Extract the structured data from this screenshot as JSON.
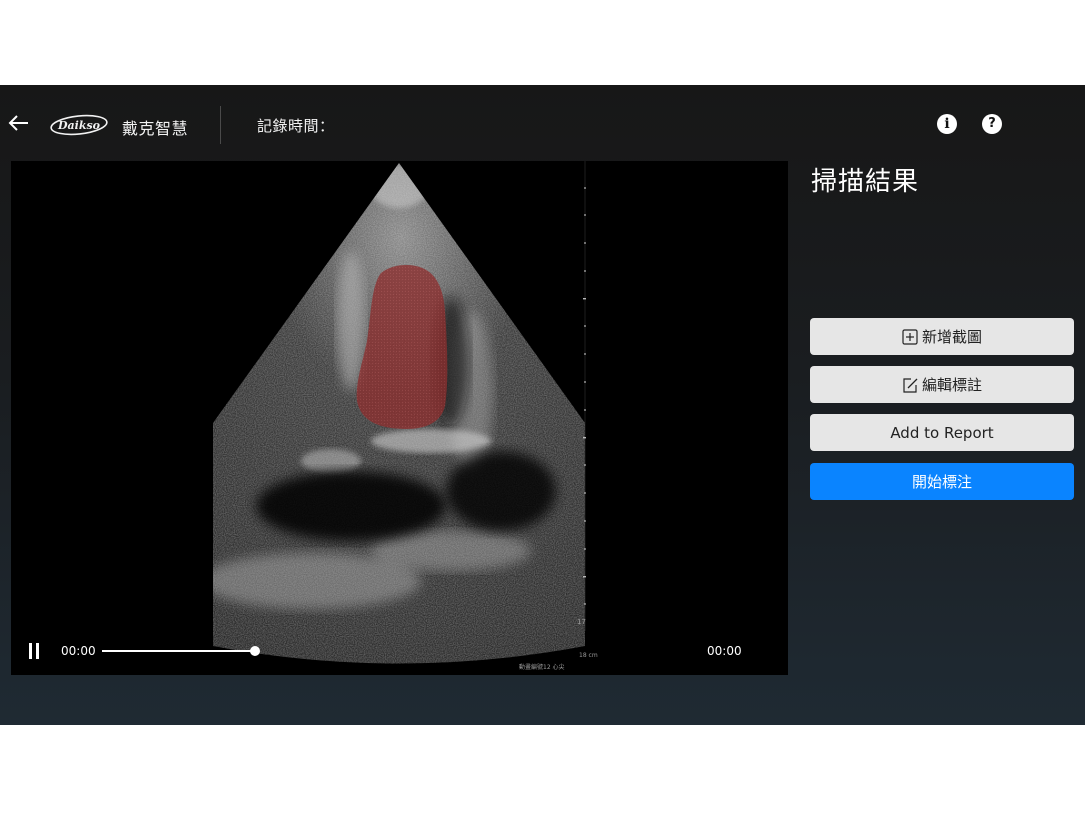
{
  "navbar": {
    "brand_logo_text": "Daikso",
    "brand_name": "戴克智慧",
    "record_time_label": "記錄時間："
  },
  "player": {
    "current_time": "00:00",
    "duration": "00:00",
    "progress": 1.0,
    "depth_marker": "17",
    "depth_unit_label": "18 cm",
    "frame_caption": "動畫編號12 心尖"
  },
  "panel": {
    "title": "掃描結果",
    "buttons": {
      "add_screenshot": "新增截圖",
      "edit_annotation": "編輯標註",
      "add_to_report": "Add to Report",
      "start_annotation": "開始標注"
    }
  },
  "colors": {
    "primary_button": "#0a84ff",
    "secondary_button": "#e6e6e6",
    "segmentation_overlay": "#8b2e2e"
  },
  "icons": {
    "back": "arrow-left-icon",
    "info": "info-icon",
    "help": "question-icon",
    "add": "plus-square-icon",
    "edit": "edit-square-icon",
    "pause": "pause-icon"
  }
}
